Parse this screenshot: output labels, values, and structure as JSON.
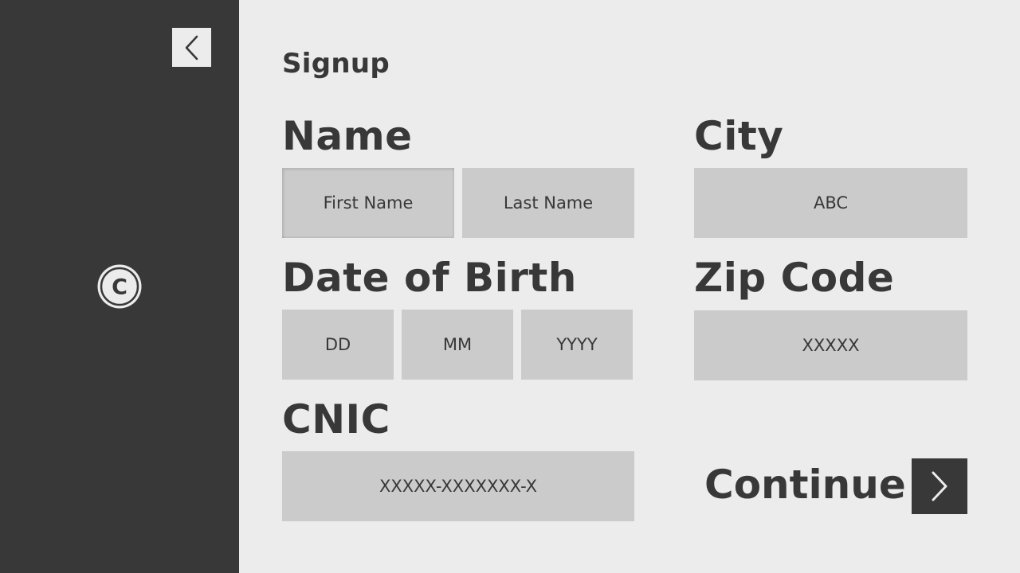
{
  "page": {
    "title": "Signup"
  },
  "sidebar": {
    "back_icon": "chevron-left-icon",
    "logo_icon": "copyright-icon",
    "logo_glyph": "C"
  },
  "form": {
    "name": {
      "label": "Name",
      "first_placeholder": "First Name",
      "last_placeholder": "Last Name"
    },
    "city": {
      "label": "City",
      "placeholder": "ABC"
    },
    "dob": {
      "label": "Date of Birth",
      "day_placeholder": "DD",
      "month_placeholder": "MM",
      "year_placeholder": "YYYY"
    },
    "zip": {
      "label": "Zip Code",
      "placeholder": "XXXXX"
    },
    "cnic": {
      "label": "CNIC",
      "placeholder": "XXXXX-XXXXXXX-X"
    }
  },
  "actions": {
    "continue_label": "Continue",
    "continue_icon": "chevron-right-icon"
  },
  "colors": {
    "dark": "#383838",
    "background": "#ececec",
    "field": "#cbcbcb"
  }
}
